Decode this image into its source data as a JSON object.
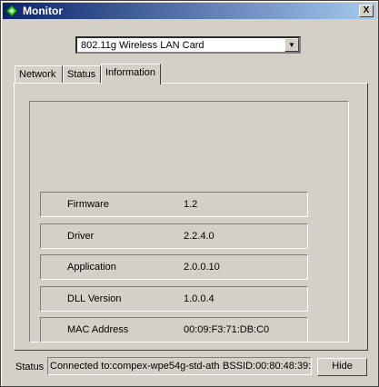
{
  "window": {
    "title": "Monitor",
    "close_glyph": "X",
    "icon": "green-diamond-icon",
    "title_gradient": [
      "#0a246a",
      "#a6caf0"
    ]
  },
  "adapter": {
    "selected": "802.11g Wireless LAN Card"
  },
  "tabs": [
    {
      "label": "Network"
    },
    {
      "label": "Status"
    },
    {
      "label": "Information",
      "active": true
    }
  ],
  "info": [
    {
      "label": "Firmware",
      "value": "1.2"
    },
    {
      "label": "Driver",
      "value": "2.2.4.0"
    },
    {
      "label": "Application",
      "value": "2.0.0.10"
    },
    {
      "label": "DLL Version",
      "value": "1.0.0.4"
    },
    {
      "label": "MAC Address",
      "value": "00:09:F3:71:DB:C0"
    }
  ],
  "status": {
    "label": "Status",
    "connection": "Connected to:compex-wpe54g-std-ath",
    "bssid": "BSSID:00:80:48:39:"
  },
  "buttons": {
    "hide": "Hide"
  }
}
